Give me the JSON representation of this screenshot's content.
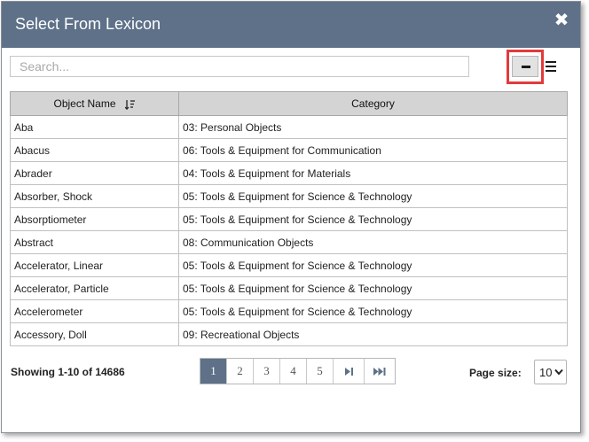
{
  "dialog": {
    "title": "Select From Lexicon",
    "close_icon": "close-icon",
    "header_color": "#5e7189"
  },
  "search": {
    "placeholder": "Search...",
    "value": ""
  },
  "view_toggle": {
    "compact_icon": "minus-icon",
    "list_icon": "list-icon",
    "highlight_color": "#e23b3b"
  },
  "table": {
    "columns": [
      "Object Name",
      "Category"
    ],
    "sort_icon": "sort-alpha-down-icon",
    "rows": [
      {
        "name": "Aba",
        "category": "03: Personal Objects"
      },
      {
        "name": "Abacus",
        "category": "06: Tools & Equipment for Communication"
      },
      {
        "name": "Abrader",
        "category": "04: Tools & Equipment for Materials"
      },
      {
        "name": "Absorber, Shock",
        "category": "05: Tools & Equipment for Science & Technology"
      },
      {
        "name": "Absorptiometer",
        "category": "05: Tools & Equipment for Science & Technology"
      },
      {
        "name": "Abstract",
        "category": "08: Communication Objects"
      },
      {
        "name": "Accelerator, Linear",
        "category": "05: Tools & Equipment for Science & Technology"
      },
      {
        "name": "Accelerator, Particle",
        "category": "05: Tools & Equipment for Science & Technology"
      },
      {
        "name": "Accelerometer",
        "category": "05: Tools & Equipment for Science & Technology"
      },
      {
        "name": "Accessory, Doll",
        "category": "09: Recreational Objects"
      }
    ]
  },
  "footer": {
    "showing": "Showing 1-10 of 14686",
    "pages": [
      "1",
      "2",
      "3",
      "4",
      "5"
    ],
    "active_page": "1",
    "next_icon": "skip-next-icon",
    "last_icon": "skip-last-icon",
    "page_size_label": "Page size:",
    "page_size_value": "10"
  }
}
